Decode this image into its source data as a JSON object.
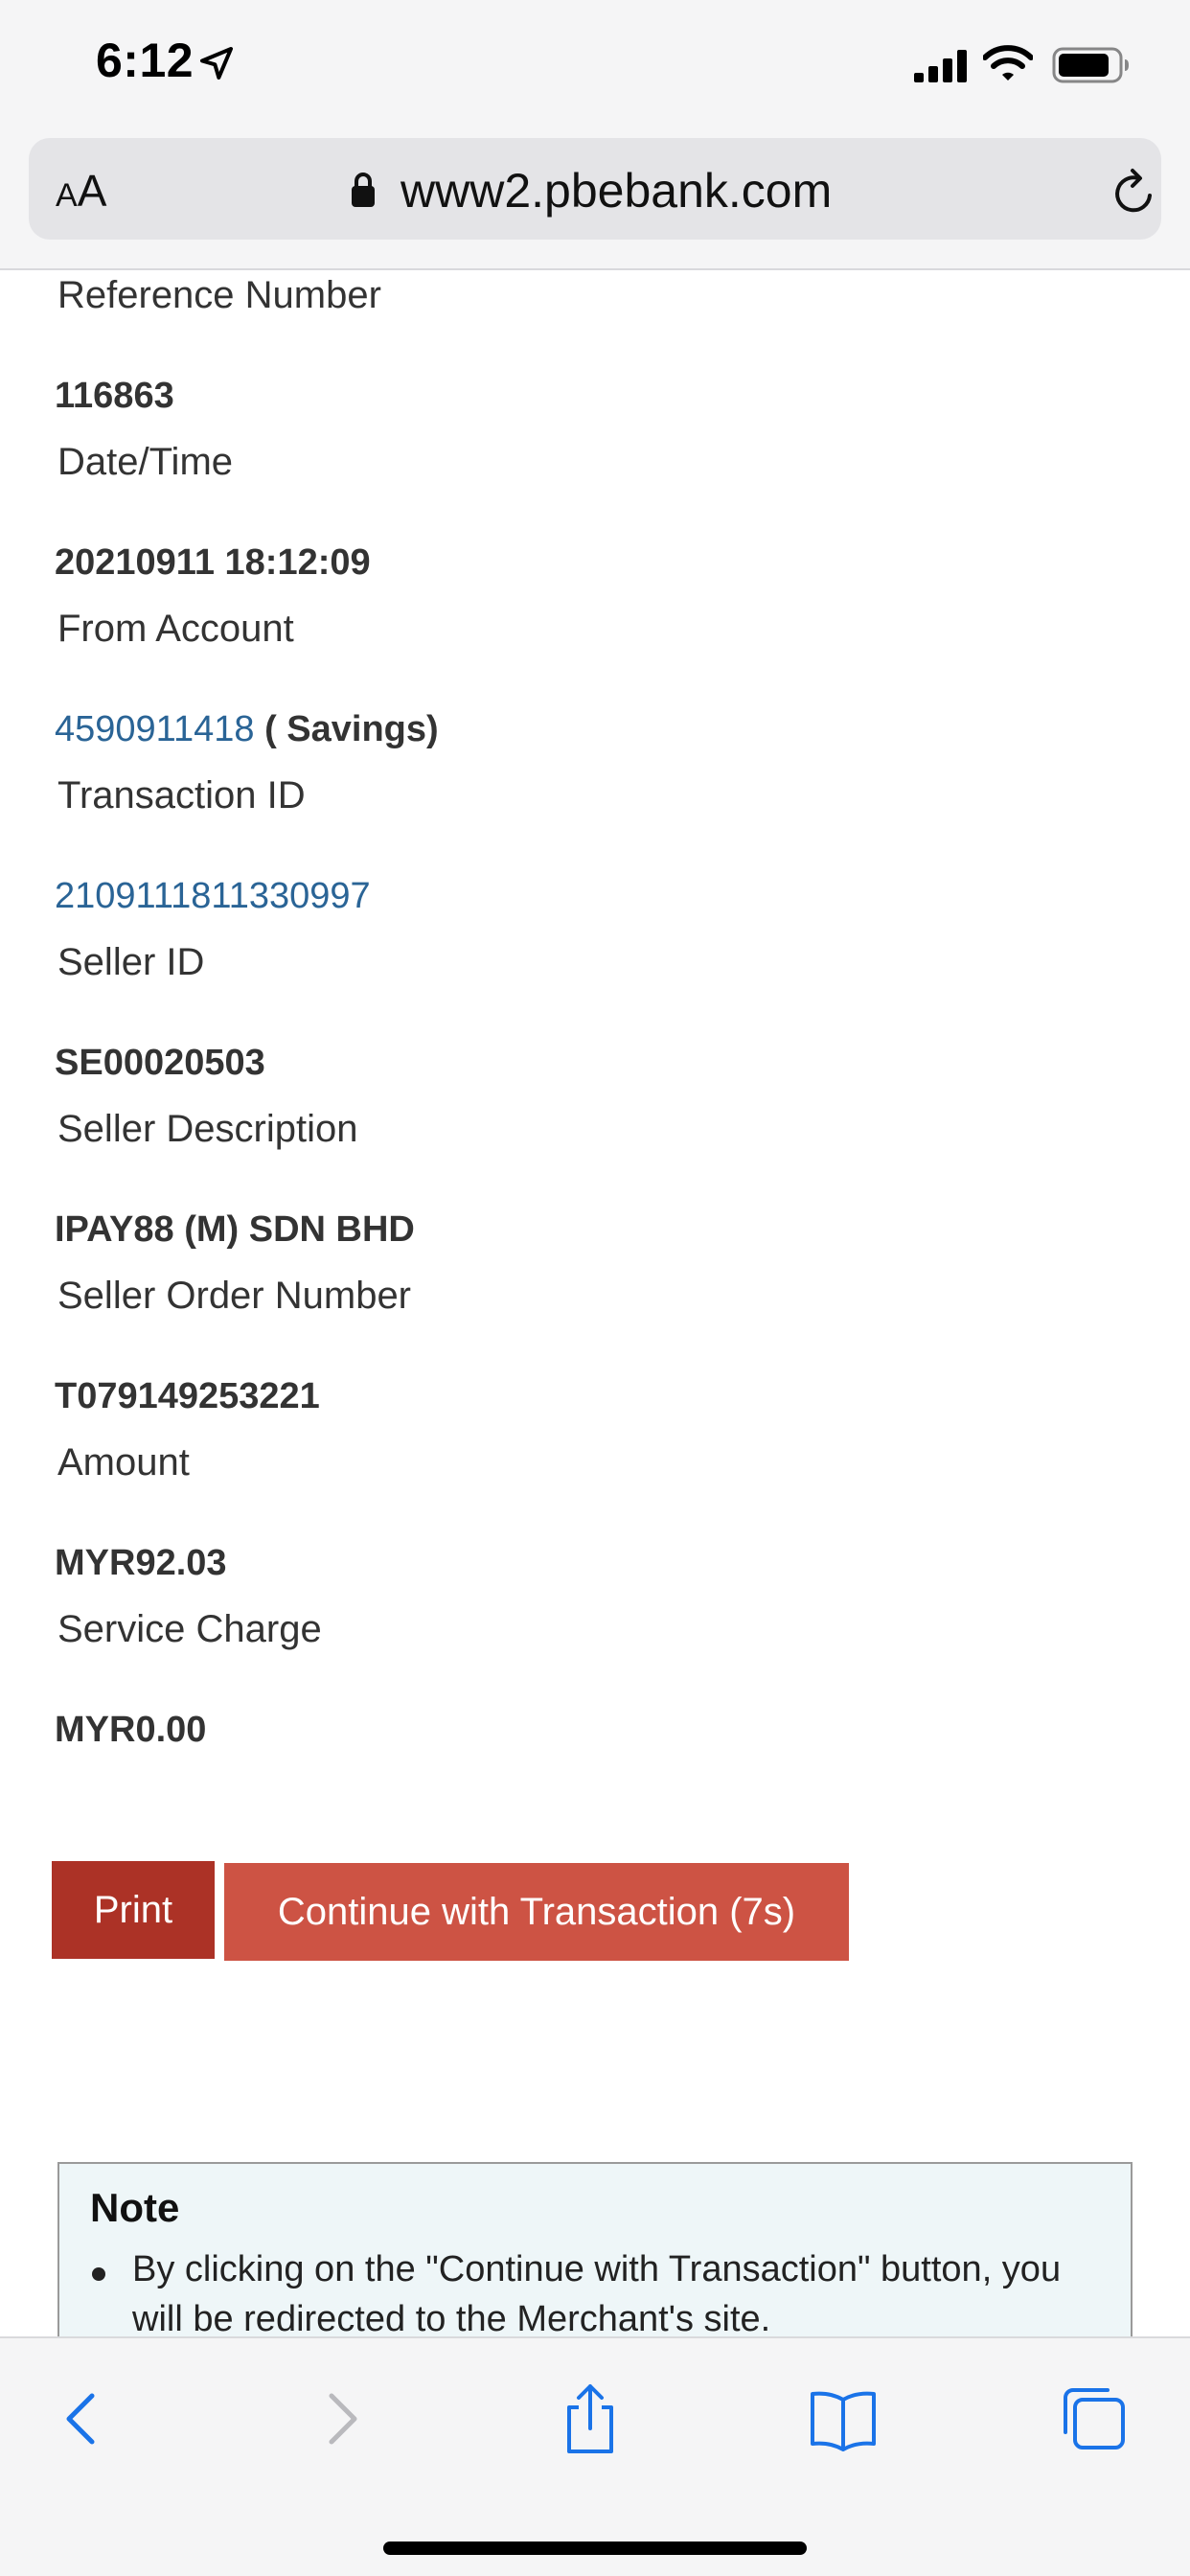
{
  "status_bar": {
    "time": "6:12"
  },
  "browser": {
    "aa_small": "A",
    "aa_large": "A",
    "url": "www2.pbebank.com"
  },
  "fields": [
    {
      "label": "Reference Number",
      "value": "116863"
    },
    {
      "label": "Date/Time",
      "value": "20210911 18:12:09"
    },
    {
      "label": "From Account",
      "value_link": "4590911418",
      "value_suffix": " ( Savings)"
    },
    {
      "label": "Transaction ID",
      "value_link": "2109111811330997"
    },
    {
      "label": "Seller ID",
      "value": "SE00020503"
    },
    {
      "label": "Seller Description",
      "value": "IPAY88 (M) SDN BHD"
    },
    {
      "label": "Seller Order Number",
      "value": "T079149253221"
    },
    {
      "label": "Amount",
      "value": "MYR92.03"
    },
    {
      "label": "Service Charge",
      "value": "MYR0.00"
    }
  ],
  "buttons": {
    "print": "Print",
    "continue": "Continue with Transaction (7s)"
  },
  "note": {
    "title": "Note",
    "text": "By clicking on the \"Continue with Transaction\" button, you will be redirected to the Merchant's site."
  },
  "colors": {
    "link": "#2a6496",
    "print_button": "#ac3226",
    "continue_button": "#cd5344",
    "toolbar_icon": "#1a73e8"
  }
}
